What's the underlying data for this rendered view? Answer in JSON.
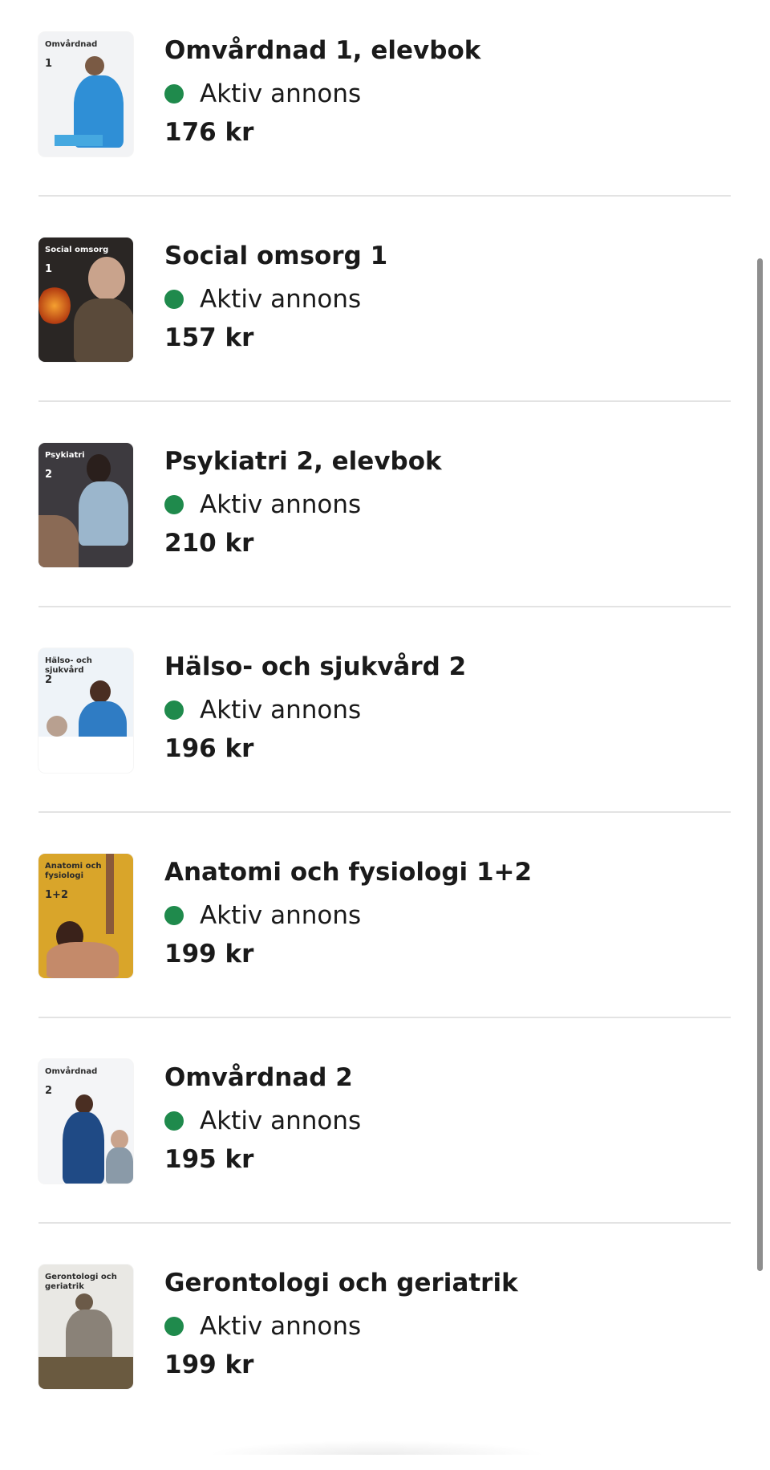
{
  "listings": [
    {
      "title": "Omvårdnad 1, elevbok",
      "status": "Aktiv annons",
      "price": "176 kr",
      "cover": {
        "title": "Omvårdnad",
        "num": "1",
        "bg": "#f2f3f5",
        "accent": "#2f8fd6",
        "text_color": "#2a2a2a"
      }
    },
    {
      "title": "Social omsorg 1",
      "status": "Aktiv annons",
      "price": "157 kr",
      "cover": {
        "title": "Social omsorg",
        "num": "1",
        "bg": "#2a2624",
        "accent": "#e0692a",
        "text_color": "#ffffff"
      }
    },
    {
      "title": "Psykiatri 2, elevbok",
      "status": "Aktiv annons",
      "price": "210 kr",
      "cover": {
        "title": "Psykiatri",
        "num": "2",
        "bg": "#3d3a3f",
        "accent": "#9bb6cc",
        "text_color": "#ffffff"
      }
    },
    {
      "title": "Hälso- och sjukvård 2",
      "status": "Aktiv annons",
      "price": "196 kr",
      "cover": {
        "title": "Hälso- och sjukvård",
        "num": "2",
        "bg": "#eef3f8",
        "accent": "#2f7cc4",
        "text_color": "#2a2a2a"
      }
    },
    {
      "title": "Anatomi och fysiologi 1+2",
      "status": "Aktiv annons",
      "price": "199 kr",
      "cover": {
        "title": "Anatomi och fysiologi",
        "num": "1+2",
        "bg": "#d9a52a",
        "accent": "#8a5a3a",
        "text_color": "#2a2a2a"
      }
    },
    {
      "title": "Omvårdnad 2",
      "status": "Aktiv annons",
      "price": "195 kr",
      "cover": {
        "title": "Omvårdnad",
        "num": "2",
        "bg": "#f4f5f7",
        "accent": "#1f4a85",
        "text_color": "#2a2a2a"
      }
    },
    {
      "title": "Gerontologi och geriatrik",
      "status": "Aktiv annons",
      "price": "199 kr",
      "cover": {
        "title": "Gerontologi och geriatrik",
        "num": "",
        "bg": "#e9e8e4",
        "accent": "#6b5a48",
        "text_color": "#2a2a2a"
      }
    }
  ],
  "colors": {
    "status_dot": "#1f8a4c",
    "divider": "#e3e3e3",
    "scrollbar": "#8e8e8e"
  }
}
